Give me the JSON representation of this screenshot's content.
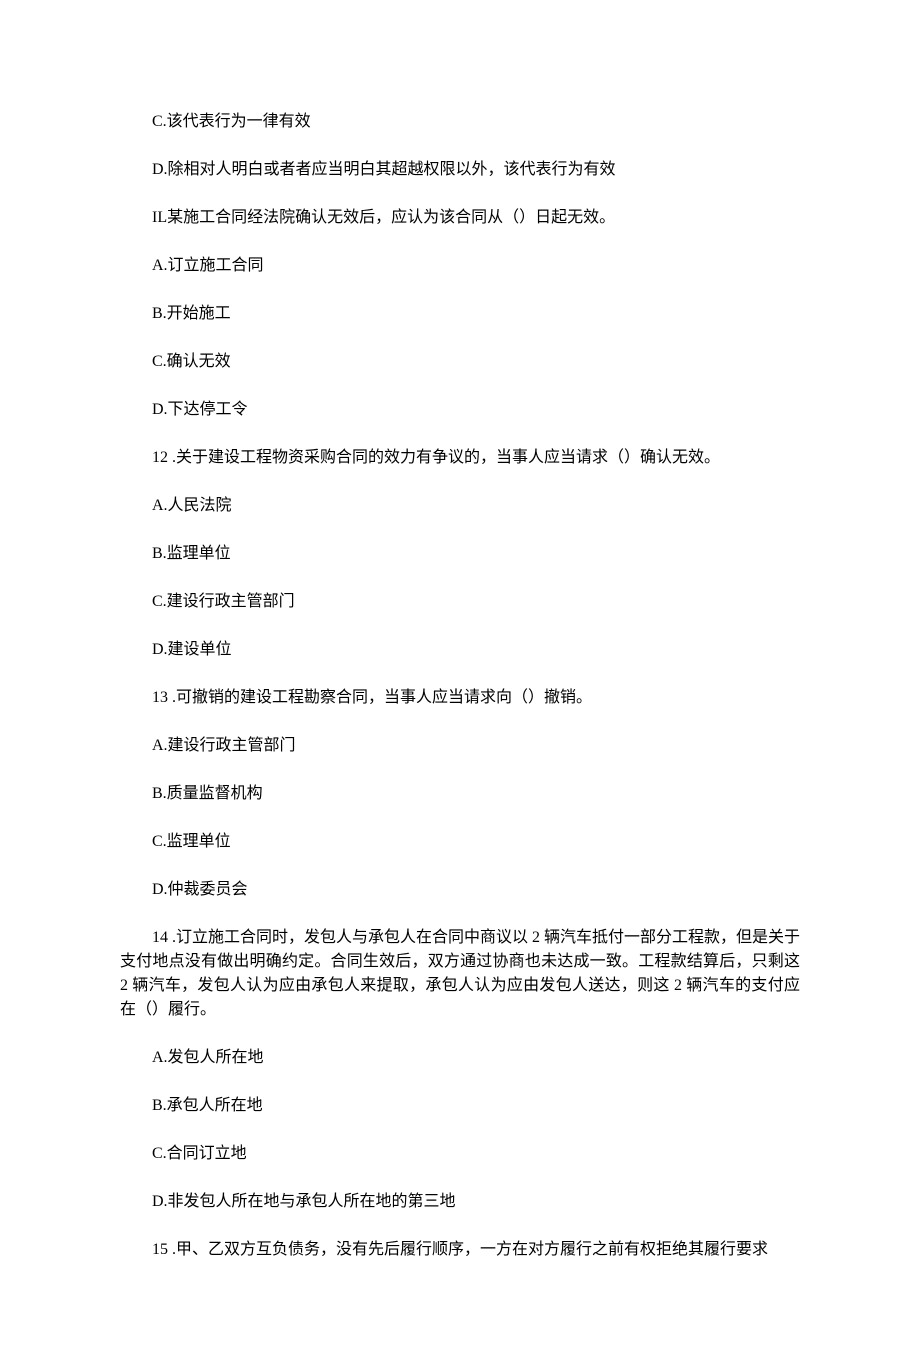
{
  "q10_optC": "C.该代表行为一律有效",
  "q10_optD": "D.除相对人明白或者者应当明白其超越权限以外，该代表行为有效",
  "q11_stem": "IL某施工合同经法院确认无效后，应认为该合同从（）日起无效。",
  "q11_optA": "A.订立施工合同",
  "q11_optB": "B.开始施工",
  "q11_optC": "C.确认无效",
  "q11_optD": "D.下达停工令",
  "q12_stem": "12 .关于建设工程物资采购合同的效力有争议的，当事人应当请求（）确认无效。",
  "q12_optA": "A.人民法院",
  "q12_optB": "B.监理单位",
  "q12_optC": "C.建设行政主管部门",
  "q12_optD": "D.建设单位",
  "q13_stem": "13 .可撤销的建设工程勘察合同，当事人应当请求向（）撤销。",
  "q13_optA": "A.建设行政主管部门",
  "q13_optB": "B.质量监督机构",
  "q13_optC": "C.监理单位",
  "q13_optD": "D.仲裁委员会",
  "q14_stem": "14 .订立施工合同时，发包人与承包人在合同中商议以 2 辆汽车抵付一部分工程款，但是关于支付地点没有做出明确约定。合同生效后，双方通过协商也未达成一致。工程款结算后，只剩这 2 辆汽车，发包人认为应由承包人来提取，承包人认为应由发包人送达，则这 2 辆汽车的支付应在（）履行。",
  "q14_optA": "A.发包人所在地",
  "q14_optB": "B.承包人所在地",
  "q14_optC": "C.合同订立地",
  "q14_optD": "D.非发包人所在地与承包人所在地的第三地",
  "q15_stem": "15 .甲、乙双方互负债务，没有先后履行顺序，一方在对方履行之前有权拒绝其履行要求"
}
